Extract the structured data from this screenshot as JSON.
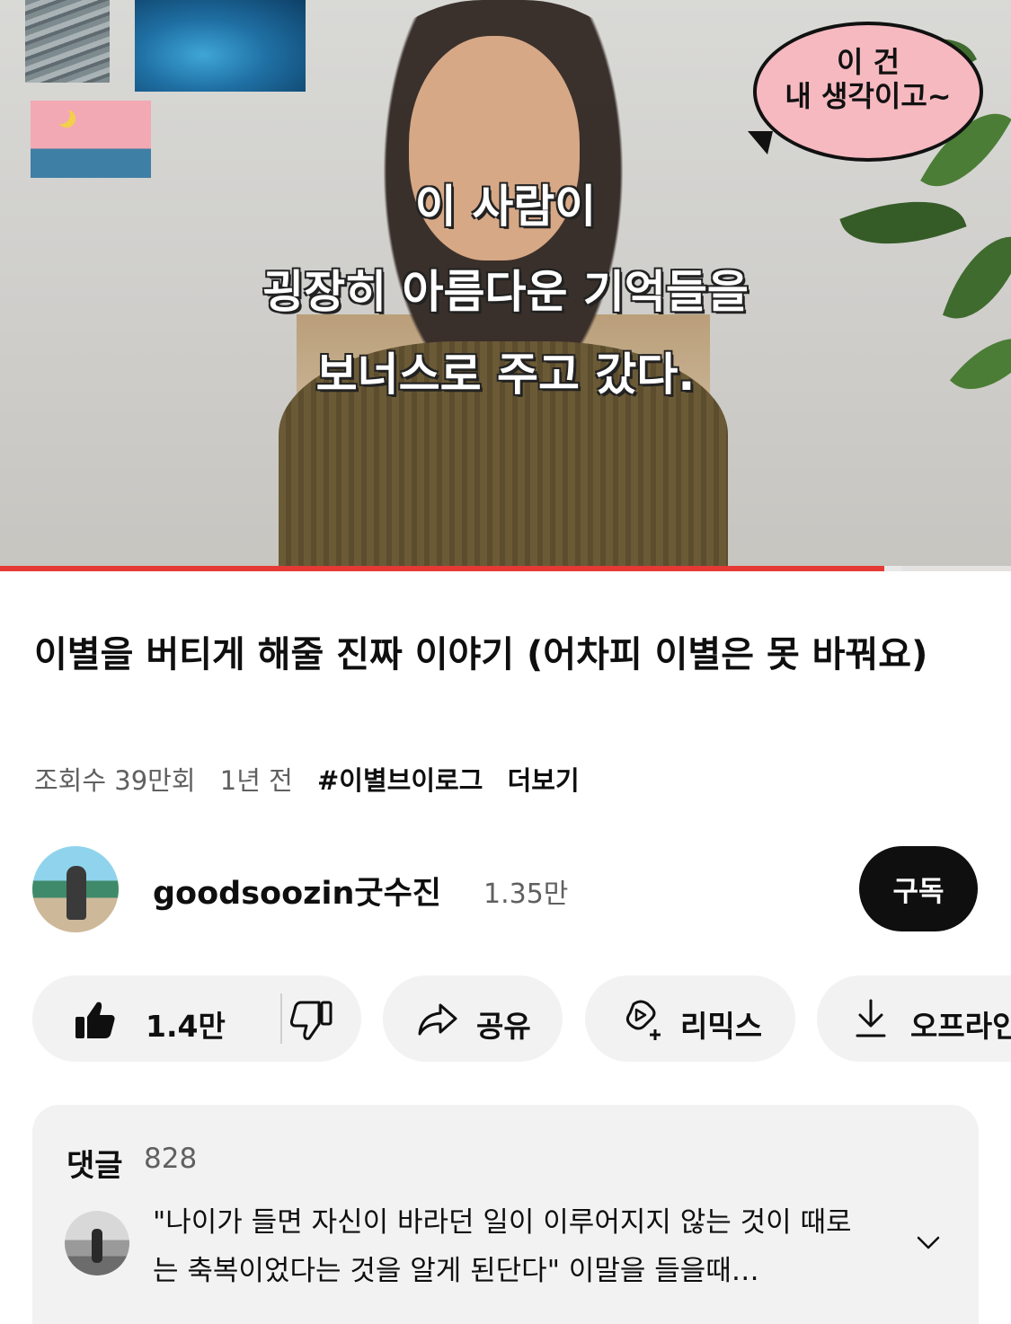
{
  "video": {
    "subtitle_lines": [
      "이 사람이",
      "굉장히 아름다운 기억들을",
      "보너스로 주고 갔다."
    ],
    "bubble_lines": [
      "이 건",
      "내 생각이고~"
    ],
    "progress_fraction": 0.875,
    "buffer_fraction": 0.893,
    "progress_color": "#e53935"
  },
  "info": {
    "title": "이별을 버티게 해줄 진짜 이야기 (어차피 이별은 못 바꿔요)",
    "views": "조회수 39만회",
    "age": "1년 전",
    "hashtag": "#이별브이로그",
    "more": "더보기"
  },
  "channel": {
    "name": "goodsoozin굿수진",
    "subscribers": "1.35만",
    "subscribe_label": "구독"
  },
  "actions": {
    "like_count": "1.4만",
    "share": "공유",
    "remix": "리믹스",
    "download": "오프라인"
  },
  "comments": {
    "title": "댓글",
    "count": "828",
    "top_comment": "\"나이가 들면 자신이 바라던 일이 이루어지지 않는 것이 때로는 축복이었다는 것을 알게 된단다\" 이말을 들을때…"
  },
  "icons": {
    "like": "thumbs-up-filled",
    "dislike": "thumbs-down-outline",
    "share": "share-arrow",
    "remix": "remix",
    "download": "download-arrow",
    "expand": "chevron-down"
  }
}
